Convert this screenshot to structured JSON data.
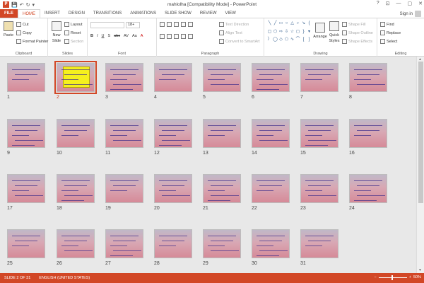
{
  "window": {
    "title": "mahlolha [Compatibility Mode] - PowerPoint",
    "controls": [
      "?",
      "⊡",
      "—",
      "▢",
      "✕"
    ]
  },
  "tabs": [
    "FILE",
    "HOME",
    "INSERT",
    "DESIGN",
    "TRANSITIONS",
    "ANIMATIONS",
    "SLIDE SHOW",
    "REVIEW",
    "VIEW"
  ],
  "active_tab": "HOME",
  "signin": "Sign in",
  "ribbon": {
    "clipboard": {
      "label": "Clipboard",
      "paste": "Paste",
      "cut": "Cut",
      "copy": "Copy",
      "format_painter": "Format Painter"
    },
    "slides": {
      "label": "Slides",
      "new_slide": "New",
      "new_slide2": "Slide",
      "layout": "Layout",
      "reset": "Reset",
      "section": "Section"
    },
    "font": {
      "label": "Font",
      "font_size": "18+",
      "items": [
        "B",
        "I",
        "U",
        "S",
        "abc",
        "AV",
        "Aa",
        "A"
      ]
    },
    "paragraph": {
      "label": "Paragraph",
      "text_direction": "Text Direction",
      "align_text": "Align Text",
      "convert": "Convert to SmartArt"
    },
    "drawing": {
      "label": "Drawing",
      "arrange": "Arrange",
      "quick_styles": "Quick",
      "quick_styles2": "Styles",
      "shape_fill": "Shape Fill",
      "shape_outline": "Shape Outline",
      "shape_effects": "Shape Effects"
    },
    "editing": {
      "label": "Editing",
      "find": "Find",
      "replace": "Replace",
      "select": "Select"
    }
  },
  "slides": [
    "1",
    "2",
    "3",
    "4",
    "5",
    "6",
    "7",
    "8",
    "9",
    "10",
    "11",
    "12",
    "13",
    "14",
    "15",
    "16",
    "17",
    "18",
    "19",
    "20",
    "21",
    "22",
    "23",
    "24",
    "25",
    "26",
    "27",
    "28",
    "29",
    "30",
    "31"
  ],
  "selected_slide": 2,
  "status": {
    "slide": "SLIDE 2 OF 31",
    "language": "ENGLISH (UNITED STATES)",
    "zoom": "50%"
  }
}
